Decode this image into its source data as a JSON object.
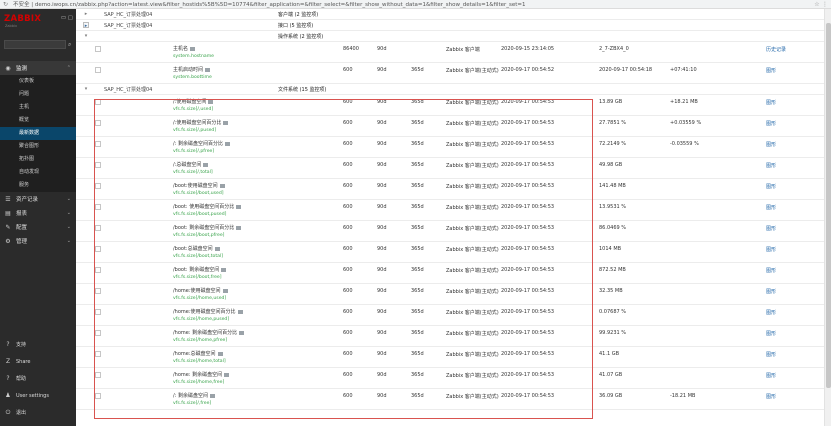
{
  "browser": {
    "url": "不安全 | demo.iwops.cn/zabbix.php?action=latest.view&filter_hostids%5B%5D=10774&filter_application=&filter_select=&filter_show_without_data=1&filter_show_details=1&filter_set=1"
  },
  "sidebar": {
    "logo": "ZABBIX",
    "logo_sub": "Zabbix",
    "menu": [
      {
        "label": "监测",
        "icon": "eye-icon",
        "glyph": "◉",
        "expanded": true
      },
      {
        "label": "资产记录",
        "icon": "list-icon",
        "glyph": "☰"
      },
      {
        "label": "报表",
        "icon": "report-icon",
        "glyph": "▤"
      },
      {
        "label": "配置",
        "icon": "wrench-icon",
        "glyph": "✎"
      },
      {
        "label": "管理",
        "icon": "gear-icon",
        "glyph": "⚙"
      }
    ],
    "submenu": [
      "仪表板",
      "问题",
      "主机",
      "概览",
      "最新数据",
      "聚合图形",
      "拓扑图",
      "自动发现",
      "服务"
    ],
    "selected_sub": "最新数据",
    "bottom": [
      {
        "label": "支持",
        "icon": "support-icon",
        "glyph": "?"
      },
      {
        "label": "Share",
        "icon": "share-icon",
        "glyph": "Z"
      },
      {
        "label": "帮助",
        "icon": "help-icon",
        "glyph": "?"
      },
      {
        "label": "User settings",
        "icon": "user-icon",
        "glyph": "♟"
      },
      {
        "label": "退出",
        "icon": "logout-icon",
        "glyph": "⏻"
      }
    ]
  },
  "groups": [
    {
      "host": "SAP_HC_订票处理04",
      "app": "客户端 (2 监控项)",
      "toggle": "▸",
      "boxed": false
    },
    {
      "host": "SAP_HC_订票处理04",
      "app": "接口 (5 监控项)",
      "toggle": "▸",
      "boxed": true
    },
    {
      "host": "",
      "app": "操作系统 (2 监控项)",
      "toggle": "▾",
      "boxed": false
    },
    {
      "host": "SAP_HC_订票处理04",
      "app": "文件系统 (15 监控项)",
      "toggle": "▾",
      "boxed": false
    }
  ],
  "os_items": [
    {
      "name": "主机名",
      "key": "system.hostname",
      "interval": "86400",
      "history": "90d",
      "trend": "",
      "type": "Zabbix 客户端",
      "time": "2020-09-15 23:14:05",
      "value": "2_7-ZBX4_0",
      "change": "",
      "action": "历史记录"
    },
    {
      "name": "主机启动时间",
      "key": "system.boottime",
      "interval": "600",
      "history": "90d",
      "trend": "365d",
      "type": "Zabbix 客户端(主动式)",
      "time": "2020-09-17 00:54:52",
      "value": "2020-09-17 00:54:18",
      "change": "+07:41:10",
      "action": "图形"
    }
  ],
  "fs_items": [
    {
      "name": "/:使用磁盘空间",
      "key": "vfs.fs.size[/,used]",
      "interval": "600",
      "history": "90d",
      "trend": "365d",
      "type": "Zabbix 客户端(主动式)",
      "time": "2020-09-17 00:54:53",
      "value": "13.89 GB",
      "change": "+18.21 MB",
      "action": "图形"
    },
    {
      "name": "/:使用磁盘空间百分比",
      "key": "vfs.fs.size[/,pused]",
      "interval": "600",
      "history": "90d",
      "trend": "365d",
      "type": "Zabbix 客户端(主动式)",
      "time": "2020-09-17 00:54:53",
      "value": "27.7851 %",
      "change": "+0.03559 %",
      "action": "图形"
    },
    {
      "name": "/: 剩余磁盘空间百分比",
      "key": "vfs.fs.size[/,pfree]",
      "interval": "600",
      "history": "90d",
      "trend": "365d",
      "type": "Zabbix 客户端(主动式)",
      "time": "2020-09-17 00:54:53",
      "value": "72.2149 %",
      "change": "-0.03559 %",
      "action": "图形"
    },
    {
      "name": "/:总磁盘空间",
      "key": "vfs.fs.size[/,total]",
      "interval": "600",
      "history": "90d",
      "trend": "365d",
      "type": "Zabbix 客户端(主动式)",
      "time": "2020-09-17 00:54:53",
      "value": "49.98 GB",
      "change": "",
      "action": "图形"
    },
    {
      "name": "/boot:使用磁盘空间",
      "key": "vfs.fs.size[/boot,used]",
      "interval": "600",
      "history": "90d",
      "trend": "365d",
      "type": "Zabbix 客户端(主动式)",
      "time": "2020-09-17 00:54:53",
      "value": "141.48 MB",
      "change": "",
      "action": "图形"
    },
    {
      "name": "/boot: 使用磁盘空间百分比",
      "key": "vfs.fs.size[/boot,pused]",
      "interval": "600",
      "history": "90d",
      "trend": "365d",
      "type": "Zabbix 客户端(主动式)",
      "time": "2020-09-17 00:54:53",
      "value": "13.9531 %",
      "change": "",
      "action": "图形"
    },
    {
      "name": "/boot: 剩余磁盘空间百分比",
      "key": "vfs.fs.size[/boot,pfree]",
      "interval": "600",
      "history": "90d",
      "trend": "365d",
      "type": "Zabbix 客户端(主动式)",
      "time": "2020-09-17 00:54:53",
      "value": "86.0469 %",
      "change": "",
      "action": "图形"
    },
    {
      "name": "/boot:总磁盘空间",
      "key": "vfs.fs.size[/boot,total]",
      "interval": "600",
      "history": "90d",
      "trend": "365d",
      "type": "Zabbix 客户端(主动式)",
      "time": "2020-09-17 00:54:53",
      "value": "1014 MB",
      "change": "",
      "action": "图形"
    },
    {
      "name": "/boot: 剩余磁盘空间",
      "key": "vfs.fs.size[/boot,free]",
      "interval": "600",
      "history": "90d",
      "trend": "365d",
      "type": "Zabbix 客户端(主动式)",
      "time": "2020-09-17 00:54:53",
      "value": "872.52 MB",
      "change": "",
      "action": "图形"
    },
    {
      "name": "/home:使用磁盘空间",
      "key": "vfs.fs.size[/home,used]",
      "interval": "600",
      "history": "90d",
      "trend": "365d",
      "type": "Zabbix 客户端(主动式)",
      "time": "2020-09-17 00:54:53",
      "value": "32.35 MB",
      "change": "",
      "action": "图形"
    },
    {
      "name": "/home:使用磁盘空间百分比",
      "key": "vfs.fs.size[/home,pused]",
      "interval": "600",
      "history": "90d",
      "trend": "365d",
      "type": "Zabbix 客户端(主动式)",
      "time": "2020-09-17 00:54:53",
      "value": "0.07687 %",
      "change": "",
      "action": "图形"
    },
    {
      "name": "/home: 剩余磁盘空间百分比",
      "key": "vfs.fs.size[/home,pfree]",
      "interval": "600",
      "history": "90d",
      "trend": "365d",
      "type": "Zabbix 客户端(主动式)",
      "time": "2020-09-17 00:54:53",
      "value": "99.9231 %",
      "change": "",
      "action": "图形"
    },
    {
      "name": "/home:总磁盘空间",
      "key": "vfs.fs.size[/home,total]",
      "interval": "600",
      "history": "90d",
      "trend": "365d",
      "type": "Zabbix 客户端(主动式)",
      "time": "2020-09-17 00:54:53",
      "value": "41.1 GB",
      "change": "",
      "action": "图形"
    },
    {
      "name": "/home: 剩余磁盘空间",
      "key": "vfs.fs.size[/home,free]",
      "interval": "600",
      "history": "90d",
      "trend": "365d",
      "type": "Zabbix 客户端(主动式)",
      "time": "2020-09-17 00:54:53",
      "value": "41.07 GB",
      "change": "",
      "action": "图形"
    },
    {
      "name": "/: 剩余磁盘空间",
      "key": "vfs.fs.size[/,free]",
      "interval": "600",
      "history": "90d",
      "trend": "365d",
      "type": "Zabbix 客户端(主动式)",
      "time": "2020-09-17 00:54:53",
      "value": "36.09 GB",
      "change": "-18.21 MB",
      "action": "图形"
    }
  ],
  "colors": {
    "accent": "#d40000",
    "link": "#1f65a8",
    "key_green": "#38a34a",
    "highlight_box": "#d9534f"
  }
}
